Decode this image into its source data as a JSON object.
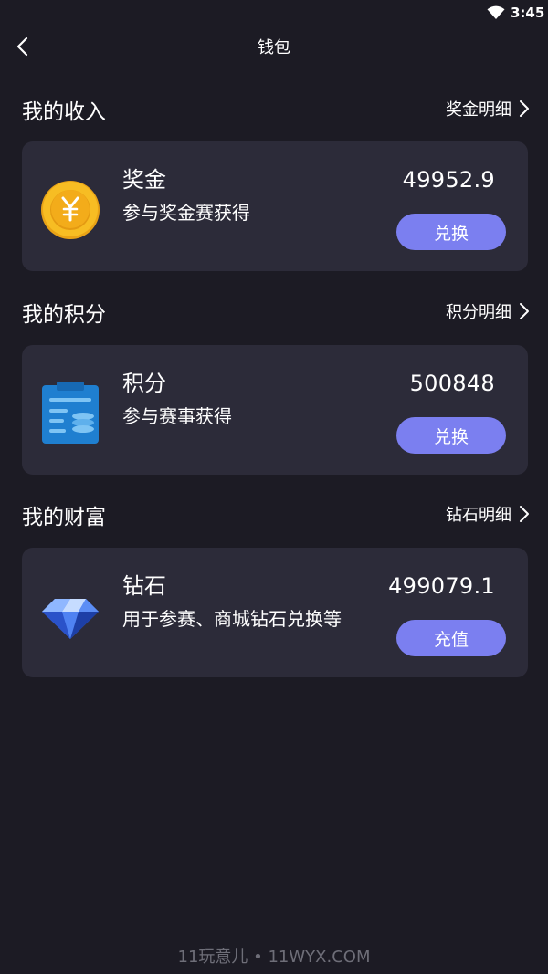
{
  "status_bar": {
    "time": "3:45",
    "icons": [
      "wifi-icon"
    ]
  },
  "header": {
    "title": "钱包",
    "back_icon": "back-arrow-icon"
  },
  "sections": [
    {
      "title": "我的收入",
      "detail_label": "奖金明细",
      "card": {
        "icon": "yuan-coin-icon",
        "name": "奖金",
        "description": "参与奖金赛获得",
        "value": "49952.9",
        "button_label": "兑换"
      }
    },
    {
      "title": "我的积分",
      "detail_label": "积分明细",
      "card": {
        "icon": "points-clipboard-icon",
        "name": "积分",
        "description": "参与赛事获得",
        "value": "500848",
        "button_label": "兑换"
      }
    },
    {
      "title": "我的财富",
      "detail_label": "钻石明细",
      "card": {
        "icon": "diamond-icon",
        "name": "钻石",
        "description": "用于参赛、商城钻石兑换等",
        "value": "499079.1",
        "button_label": "充值"
      }
    }
  ],
  "watermark": "11玩意儿 • 11WYX.COM",
  "colors": {
    "background": "#1c1b24",
    "card": "#2c2b39",
    "button": "#7b7ff0",
    "coin": "#f5b91f",
    "clipboard": "#1f7fd0",
    "diamond": "#3f6fe8"
  }
}
